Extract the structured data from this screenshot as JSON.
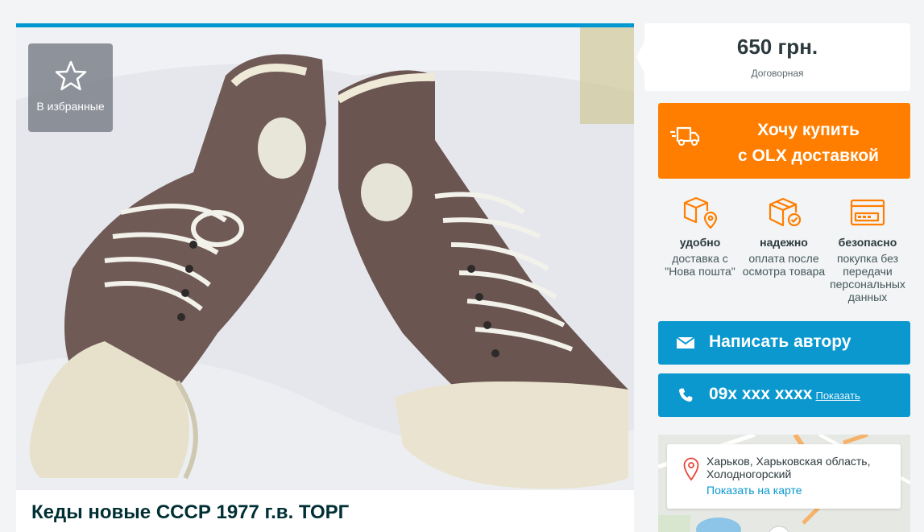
{
  "ad": {
    "title": "Кеды новые СССР 1977 г.в. ТОРГ",
    "favorite_label": "В избранные"
  },
  "price": {
    "amount": "650 грн.",
    "note": "Договорная"
  },
  "buy_button": {
    "line1": "Хочу купить",
    "line2": "с OLX доставкой"
  },
  "features": [
    {
      "icon": "box-location-icon",
      "title": "удобно",
      "desc": "доставка с \"Нова пошта\""
    },
    {
      "icon": "box-check-icon",
      "title": "надежно",
      "desc": "оплата после осмотра товара"
    },
    {
      "icon": "card-icon",
      "title": "безопасно",
      "desc": "покупка без передачи персональных данных"
    }
  ],
  "contact": {
    "message_label": "Написать автору",
    "phone_masked": "09x xxx xxxx",
    "show_label": "Показать"
  },
  "location": {
    "address": "Харьков, Харьковская область, Холодногорский",
    "map_link": "Показать на карте"
  },
  "colors": {
    "accent_orange": "#ff7e00",
    "accent_blue": "#0a98cf",
    "title_text": "#002f34"
  }
}
